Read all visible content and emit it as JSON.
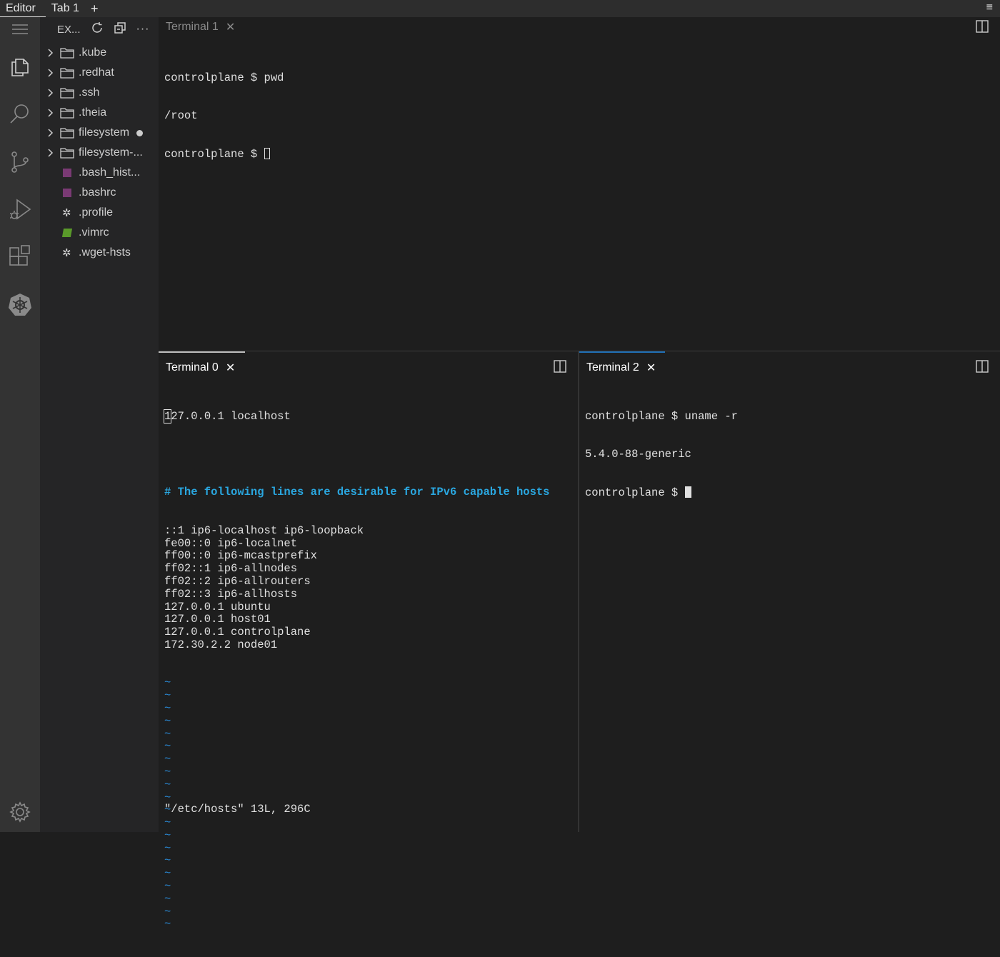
{
  "topbar": {
    "tabs": [
      {
        "label": "Editor"
      },
      {
        "label": "Tab 1"
      }
    ],
    "add": "+",
    "menu": "≡"
  },
  "explorer": {
    "title": "EX...",
    "items": [
      {
        "label": ".kube",
        "kind": "folder"
      },
      {
        "label": ".redhat",
        "kind": "folder"
      },
      {
        "label": ".ssh",
        "kind": "folder"
      },
      {
        "label": ".theia",
        "kind": "folder"
      },
      {
        "label": "filesystem",
        "kind": "folder",
        "modified": true
      },
      {
        "label": "filesystem-...",
        "kind": "folder"
      },
      {
        "label": ".bash_hist...",
        "kind": "terminal-file"
      },
      {
        "label": ".bashrc",
        "kind": "terminal-file"
      },
      {
        "label": ".profile",
        "kind": "gear-file"
      },
      {
        "label": ".vimrc",
        "kind": "vim-file"
      },
      {
        "label": ".wget-hsts",
        "kind": "gear-file"
      }
    ]
  },
  "terminal1": {
    "tab_label": "Terminal 1",
    "lines": [
      "controlplane $ pwd",
      "/root",
      "controlplane $ "
    ]
  },
  "terminal0": {
    "tab_label": "Terminal 0",
    "first_char": "1",
    "first_rest": "27.0.0.1 localhost",
    "comment": "# The following lines are desirable for IPv6 capable hosts",
    "lines": [
      "::1 ip6-localhost ip6-loopback",
      "fe00::0 ip6-localnet",
      "ff00::0 ip6-mcastprefix",
      "ff02::1 ip6-allnodes",
      "ff02::2 ip6-allrouters",
      "ff02::3 ip6-allhosts",
      "127.0.0.1 ubuntu",
      "127.0.0.1 host01",
      "127.0.0.1 controlplane",
      "172.30.2.2 node01"
    ],
    "tilde": "~",
    "tilde_count": 20,
    "status": "\"/etc/hosts\" 13L, 296C"
  },
  "terminal2": {
    "tab_label": "Terminal 2",
    "lines": [
      "controlplane $ uname -r",
      "5.4.0-88-generic",
      "controlplane $ "
    ]
  },
  "colors": {
    "background": "#1e1e1e",
    "sidebar": "#252526",
    "activity_bar": "#333333",
    "comment": "#2aa7e0",
    "tilde": "#2a8ad6",
    "active_tab_border": "#1f6fb5"
  },
  "icons": [
    "menu-icon",
    "explorer-icon",
    "search-icon",
    "source-control-icon",
    "run-debug-icon",
    "extensions-icon",
    "kubernetes-icon",
    "settings-gear-icon",
    "refresh-icon",
    "collapse-all-icon",
    "more-icon",
    "split-editor-icon",
    "close-icon",
    "chevron-right-icon",
    "folder-icon"
  ]
}
